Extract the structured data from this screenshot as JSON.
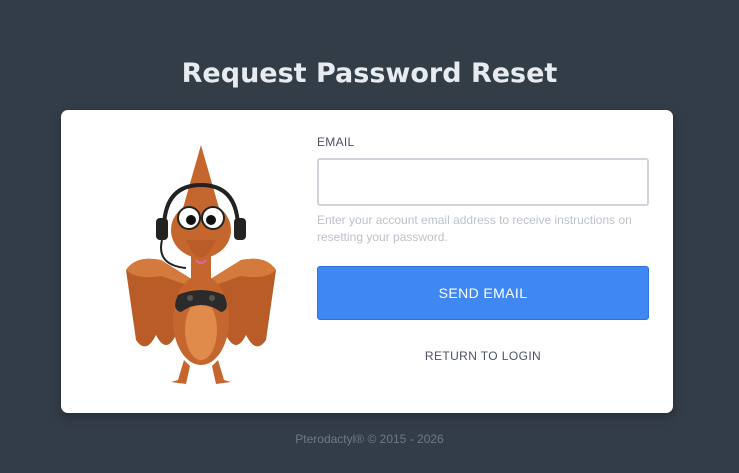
{
  "header": {
    "title": "Request Password Reset"
  },
  "form": {
    "email_label": "EMAIL",
    "email_value": "",
    "helper_text": "Enter your account email address to receive instructions on resetting your password.",
    "submit_label": "SEND EMAIL",
    "return_label": "RETURN TO LOGIN"
  },
  "mascot": {
    "icon": "pterodactyl-gamer-mascot"
  },
  "footer": {
    "text": "Pterodactyl® © 2015 - 2026"
  },
  "colors": {
    "background": "#333d48",
    "card": "#ffffff",
    "primary_button": "#3f87f3",
    "mascot_body": "#c5662e"
  }
}
